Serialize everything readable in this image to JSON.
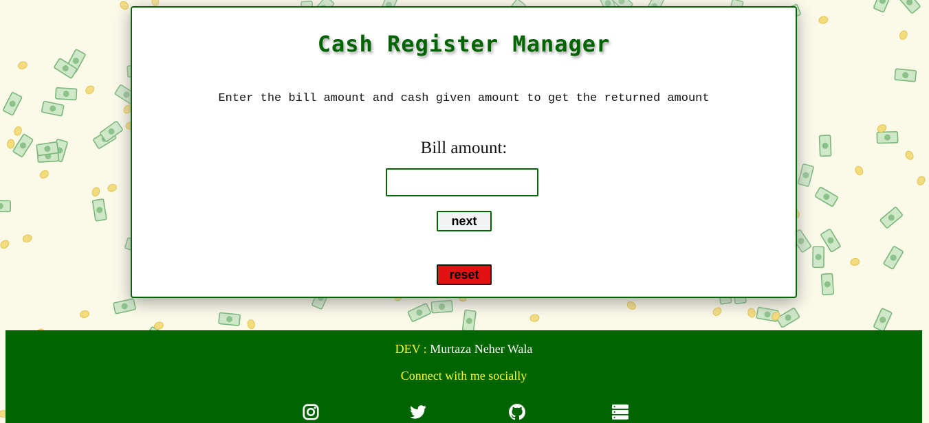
{
  "app": {
    "title": "Cash Register Manager",
    "subtitle": "Enter the bill amount and cash given amount to get the returned amount"
  },
  "form": {
    "bill_label": "Bill amount:",
    "bill_value": "",
    "next_label": "next",
    "reset_label": "reset"
  },
  "footer": {
    "dev_label": "DEV",
    "dev_separator": " : ",
    "dev_name": "Murtaza Neher Wala",
    "connect_text": "Connect with me socially",
    "social_icons": [
      "instagram-icon",
      "twitter-icon",
      "github-icon",
      "server-icon"
    ]
  },
  "colors": {
    "primary": "#006400",
    "accent_text": "#ffff33",
    "reset_button": "#e31212",
    "background": "#fbf9e8"
  }
}
